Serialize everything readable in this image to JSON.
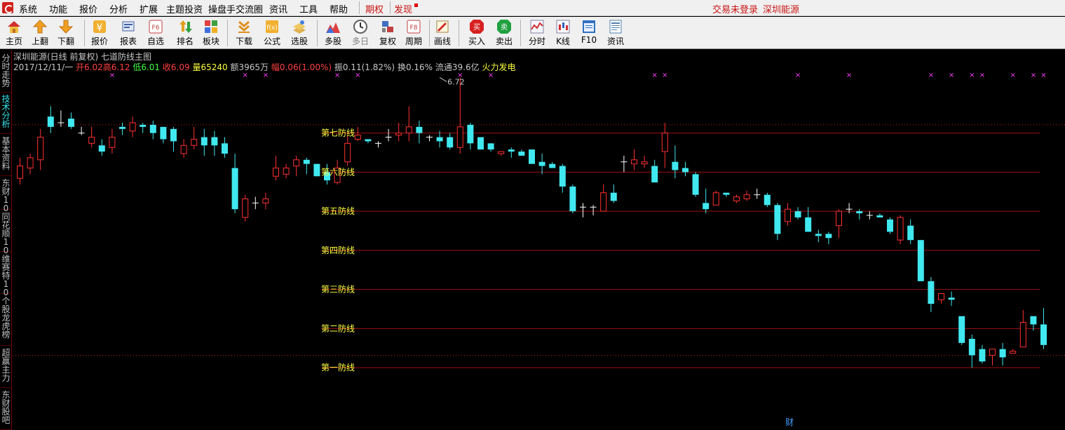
{
  "menu": {
    "items": [
      "系统",
      "功能",
      "报价",
      "分析",
      "扩展",
      "主题投资",
      "操盘手交流圈",
      "资讯",
      "工具",
      "帮助"
    ],
    "options": "期权",
    "discover": "发现",
    "trade_status": "交易未登录",
    "stock_name": "深圳能源"
  },
  "toolbar": {
    "items": [
      "主页",
      "上翻",
      "下翻",
      "报价",
      "报表",
      "自选",
      "排名",
      "板块",
      "下载",
      "公式",
      "选股",
      "多股",
      "多日",
      "复权",
      "周期",
      "画线",
      "买入",
      "卖出",
      "分时",
      "K线",
      "F10",
      "资讯"
    ],
    "f6": "F6",
    "f8": "F8",
    "buy_glyph": "买",
    "sell_glyph": "卖"
  },
  "sidetabs": [
    "分时走势",
    "技术分析",
    "基本资料",
    "东财10",
    "同花顺10",
    "维赛特10",
    "个股龙虎榜",
    "超赢主力",
    "东财股吧"
  ],
  "header": {
    "title": "深圳能源(日线 前复权) 七道防线主图",
    "date": "2017/12/11/一",
    "open": "开6.02",
    "high": "高6.12",
    "low": "低6.01",
    "close": "收6.09",
    "volume": "量65240",
    "amount": "额3965万",
    "change": "幅0.06(1.00%)",
    "amplitude": "振0.11(1.82%)",
    "turnover": "换0.16%",
    "float": "流通39.6亿",
    "signal": "火力发电"
  },
  "chart_data": {
    "type": "candlestick",
    "price_range": [
      5.15,
      6.8
    ],
    "high_marker": "6.72",
    "footer_marker": "财",
    "defense_lines": [
      {
        "name": "第七防线",
        "value": 6.45
      },
      {
        "name": "第六防线",
        "value": 6.26
      },
      {
        "name": "第五防线",
        "value": 6.07
      },
      {
        "name": "第四防线",
        "value": 5.88
      },
      {
        "name": "第三防线",
        "value": 5.69
      },
      {
        "name": "第二防线",
        "value": 5.5
      },
      {
        "name": "第一防线",
        "value": 5.31
      }
    ],
    "reference_levels": [
      6.49,
      5.37
    ],
    "candles": [
      [
        6.23,
        6.29,
        6.2,
        6.33
      ],
      [
        6.28,
        6.33,
        6.25,
        6.35
      ],
      [
        6.32,
        6.43,
        6.27,
        6.47
      ],
      [
        6.53,
        6.48,
        6.45,
        6.58
      ],
      [
        6.5,
        6.5,
        6.48,
        6.56
      ],
      [
        6.52,
        6.48,
        6.47,
        6.55
      ],
      [
        6.45,
        6.45,
        6.44,
        6.48
      ],
      [
        6.4,
        6.43,
        6.38,
        6.48
      ],
      [
        6.39,
        6.36,
        6.34,
        6.42
      ],
      [
        6.38,
        6.43,
        6.35,
        6.47
      ],
      [
        6.48,
        6.47,
        6.44,
        6.5
      ],
      [
        6.46,
        6.5,
        6.43,
        6.53
      ],
      [
        6.49,
        6.48,
        6.45,
        6.5
      ],
      [
        6.49,
        6.45,
        6.42,
        6.51
      ],
      [
        6.48,
        6.42,
        6.4,
        6.48
      ],
      [
        6.47,
        6.41,
        6.36,
        6.48
      ],
      [
        6.35,
        6.39,
        6.33,
        6.42
      ],
      [
        6.39,
        6.42,
        6.37,
        6.48
      ],
      [
        6.43,
        6.39,
        6.34,
        6.47
      ],
      [
        6.43,
        6.39,
        6.34,
        6.46
      ],
      [
        6.4,
        6.35,
        6.33,
        6.43
      ],
      [
        6.28,
        6.08,
        6.06,
        6.35
      ],
      [
        6.04,
        6.13,
        6.02,
        6.15
      ],
      [
        6.11,
        6.11,
        6.08,
        6.14
      ],
      [
        6.11,
        6.13,
        6.08,
        6.16
      ],
      [
        6.24,
        6.28,
        6.22,
        6.34
      ],
      [
        6.25,
        6.28,
        6.23,
        6.3
      ],
      [
        6.29,
        6.32,
        6.24,
        6.34
      ],
      [
        6.32,
        6.3,
        6.25,
        6.33
      ],
      [
        6.3,
        6.24,
        6.24,
        6.3
      ],
      [
        6.26,
        6.22,
        6.2,
        6.3
      ],
      [
        6.21,
        6.28,
        6.2,
        6.32
      ],
      [
        6.31,
        6.4,
        6.29,
        6.44
      ],
      [
        6.42,
        6.44,
        6.41,
        6.48
      ],
      [
        6.42,
        6.41,
        6.4,
        6.42
      ],
      [
        6.4,
        6.4,
        6.38,
        6.41
      ],
      [
        6.43,
        6.43,
        6.41,
        6.47
      ],
      [
        6.44,
        6.45,
        6.41,
        6.5
      ],
      [
        6.45,
        6.48,
        6.41,
        6.58
      ],
      [
        6.48,
        6.45,
        6.4,
        6.51
      ],
      [
        6.43,
        6.43,
        6.41,
        6.44
      ],
      [
        6.43,
        6.41,
        6.38,
        6.46
      ],
      [
        6.43,
        6.38,
        6.37,
        6.45
      ],
      [
        6.38,
        6.48,
        6.35,
        6.72
      ],
      [
        6.49,
        6.4,
        6.37,
        6.5
      ],
      [
        6.43,
        6.37,
        6.37,
        6.43
      ],
      [
        6.4,
        6.37,
        6.36,
        6.4
      ],
      [
        6.35,
        6.36,
        6.34,
        6.36
      ],
      [
        6.37,
        6.36,
        6.33,
        6.38
      ],
      [
        6.36,
        6.34,
        6.34,
        6.37
      ],
      [
        6.37,
        6.3,
        6.3,
        6.37
      ],
      [
        6.31,
        6.29,
        6.25,
        6.35
      ],
      [
        6.3,
        6.28,
        6.28,
        6.31
      ],
      [
        6.29,
        6.19,
        6.16,
        6.3
      ],
      [
        6.19,
        6.07,
        6.06,
        6.2
      ],
      [
        6.09,
        6.09,
        6.04,
        6.11
      ],
      [
        6.09,
        6.09,
        6.05,
        6.1
      ],
      [
        6.07,
        6.16,
        6.07,
        6.2
      ],
      [
        6.16,
        6.12,
        6.11,
        6.2
      ],
      [
        6.31,
        6.31,
        6.26,
        6.34
      ],
      [
        6.3,
        6.32,
        6.27,
        6.37
      ],
      [
        6.3,
        6.31,
        6.28,
        6.34
      ],
      [
        6.29,
        6.21,
        6.21,
        6.32
      ],
      [
        6.36,
        6.45,
        6.28,
        6.5
      ],
      [
        6.31,
        6.27,
        6.23,
        6.39
      ],
      [
        6.28,
        6.26,
        6.24,
        6.31
      ],
      [
        6.25,
        6.15,
        6.14,
        6.26
      ],
      [
        6.11,
        6.08,
        6.06,
        6.18
      ],
      [
        6.1,
        6.16,
        6.1,
        6.17
      ],
      [
        6.16,
        6.15,
        6.14,
        6.16
      ],
      [
        6.12,
        6.14,
        6.11,
        6.15
      ],
      [
        6.13,
        6.15,
        6.12,
        6.17
      ],
      [
        6.15,
        6.15,
        6.13,
        6.18
      ],
      [
        6.15,
        6.1,
        6.09,
        6.16
      ],
      [
        6.1,
        5.96,
        5.93,
        6.11
      ],
      [
        6.02,
        6.08,
        6.0,
        6.11
      ],
      [
        6.07,
        6.04,
        6.03,
        6.09
      ],
      [
        6.04,
        5.97,
        5.97,
        6.09
      ],
      [
        5.96,
        5.95,
        5.92,
        5.98
      ],
      [
        5.96,
        5.94,
        5.91,
        5.97
      ],
      [
        6.0,
        6.07,
        5.94,
        6.08
      ],
      [
        6.08,
        6.08,
        6.06,
        6.11
      ],
      [
        6.07,
        6.06,
        6.03,
        6.08
      ],
      [
        6.05,
        6.05,
        6.03,
        6.07
      ],
      [
        6.05,
        6.04,
        6.04,
        6.06
      ],
      [
        6.03,
        5.97,
        5.96,
        6.04
      ],
      [
        5.93,
        6.04,
        5.91,
        6.05
      ],
      [
        6.0,
        5.93,
        5.91,
        6.03
      ],
      [
        5.93,
        5.73,
        5.73,
        5.93
      ],
      [
        5.73,
        5.62,
        5.58,
        5.75
      ],
      [
        5.64,
        5.67,
        5.62,
        5.67
      ],
      [
        5.65,
        5.64,
        5.61,
        5.68
      ],
      [
        5.56,
        5.43,
        5.42,
        5.56
      ],
      [
        5.45,
        5.37,
        5.31,
        5.47
      ],
      [
        5.4,
        5.34,
        5.33,
        5.42
      ],
      [
        5.37,
        5.4,
        5.32,
        5.4
      ],
      [
        5.4,
        5.36,
        5.32,
        5.43
      ],
      [
        5.38,
        5.39,
        5.38,
        5.4
      ],
      [
        5.41,
        5.53,
        5.41,
        5.59
      ],
      [
        5.56,
        5.52,
        5.49,
        5.56
      ],
      [
        5.52,
        5.42,
        5.4,
        5.6
      ]
    ]
  },
  "colors": {
    "up": "#ff3030",
    "down": "#40e8f0",
    "line": "#a01010",
    "line_label": "#ffff40",
    "marker": "#ff40ff",
    "dotted": "#c02020"
  }
}
